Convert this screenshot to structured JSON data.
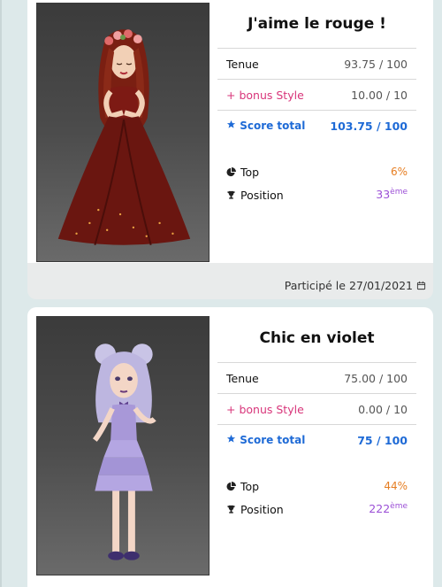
{
  "cards": [
    {
      "title": "J'aime le rouge !",
      "tenue_label": "Tenue",
      "tenue_value": "93.75 / 100",
      "bonus_label": "+ bonus Style",
      "bonus_value": "10.00 / 10",
      "total_label": "Score total",
      "total_value": "103.75 / 100",
      "top_label": "Top",
      "top_value": "6%",
      "position_label": "Position",
      "position_value": "33",
      "position_suffix": "ème",
      "footer": "Participé le 27/01/2021"
    },
    {
      "title": "Chic en violet",
      "tenue_label": "Tenue",
      "tenue_value": "75.00 / 100",
      "bonus_label": "+ bonus Style",
      "bonus_value": "0.00 / 10",
      "total_label": "Score total",
      "total_value": "75 / 100",
      "top_label": "Top",
      "top_value": "44%",
      "position_label": "Position",
      "position_value": "222",
      "position_suffix": "ème"
    }
  ],
  "colors": {
    "bonus": "#d8357a",
    "total": "#1e6ad6",
    "top": "#e67e22",
    "position": "#9b4fd6"
  },
  "icons": [
    "star-icon",
    "pie-chart-icon",
    "trophy-icon",
    "calendar-icon"
  ]
}
